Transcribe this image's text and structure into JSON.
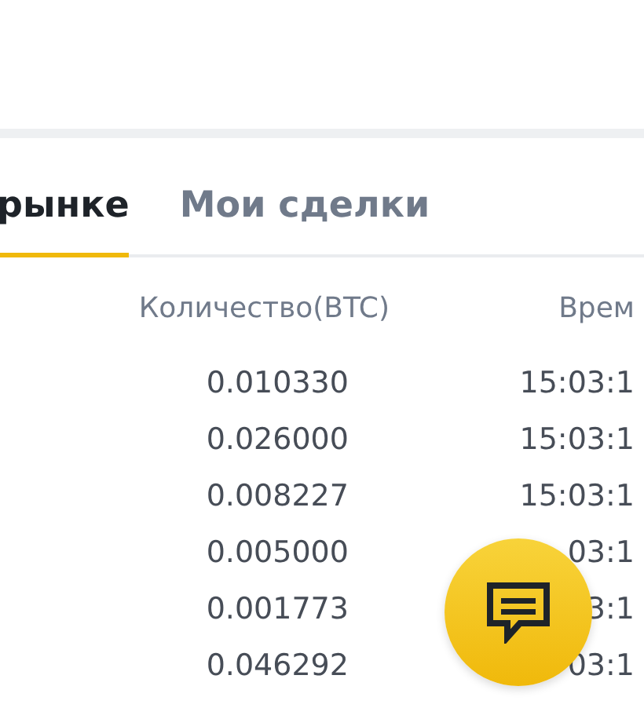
{
  "tabs": [
    {
      "label": "рынке",
      "selected": true
    },
    {
      "label": "Мои сделки",
      "selected": false
    }
  ],
  "table": {
    "columns": [
      "Количество(BTC)",
      "Врем"
    ],
    "rows": [
      {
        "amount": "0.010330",
        "time": "15:03:1"
      },
      {
        "amount": "0.026000",
        "time": "15:03:1"
      },
      {
        "amount": "0.008227",
        "time": "15:03:1"
      },
      {
        "amount": "0.005000",
        "time": "03:1"
      },
      {
        "amount": "0.001773",
        "time": "3:1"
      },
      {
        "amount": "0.046292",
        "time": "03:1"
      }
    ]
  },
  "chat_button": {
    "kind": "fab"
  }
}
